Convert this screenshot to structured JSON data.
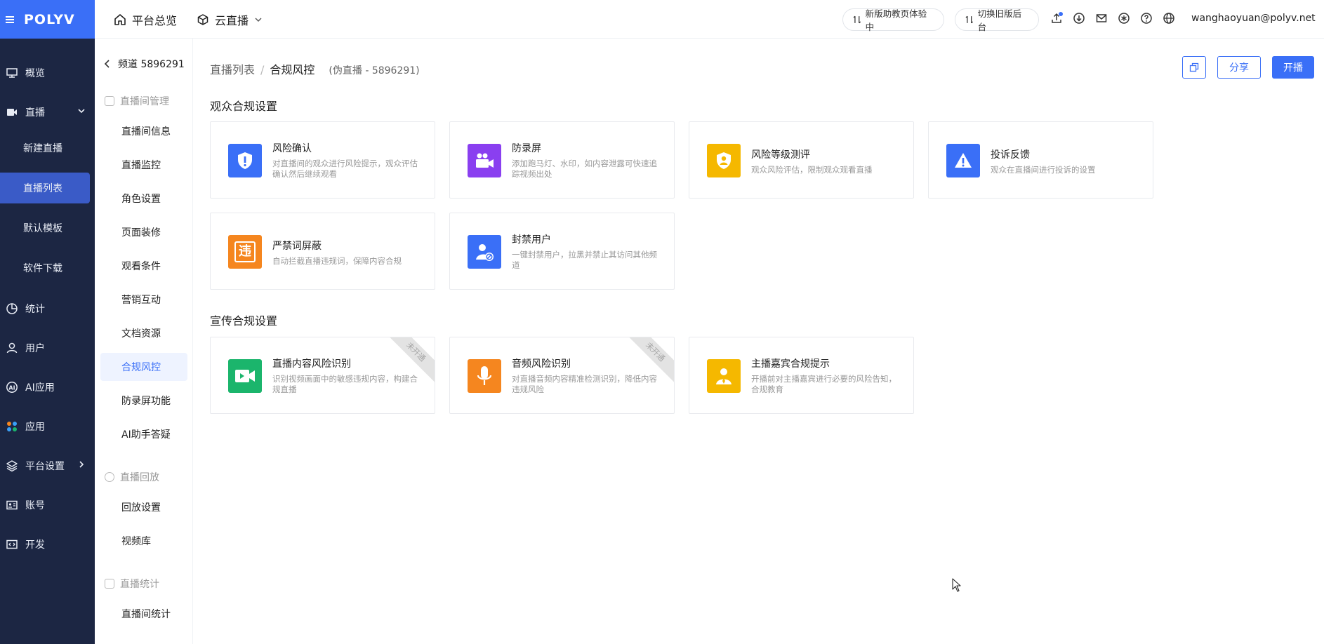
{
  "header": {
    "brand": "POLYV",
    "nav_home": "平台总览",
    "nav_cloud": "云直播",
    "pill_newpage": "新版助教页体验中",
    "pill_oldpage": "切换旧版后台",
    "user_email": "wanghaoyuan@polyv.net"
  },
  "sidebar": {
    "overview": "概览",
    "live": "直播",
    "live_sub": [
      "新建直播",
      "直播列表",
      "默认模板",
      "软件下载"
    ],
    "stats": "统计",
    "users": "用户",
    "ai_apps": "AI应用",
    "apps": "应用",
    "platform_settings": "平台设置",
    "account": "账号",
    "dev": "开发"
  },
  "submenu": {
    "channel": "频道 5896291",
    "group_room": "直播间管理",
    "room_items": [
      "直播间信息",
      "直播监控",
      "角色设置",
      "页面装修",
      "观看条件",
      "营销互动",
      "文档资源",
      "合规风控",
      "防录屏功能",
      "AI助手答疑"
    ],
    "group_replay": "直播回放",
    "replay_items": [
      "回放设置",
      "视频库"
    ],
    "group_stats": "直播统计",
    "stats_items": [
      "直播间统计"
    ]
  },
  "main": {
    "breadcrumb_parent": "直播列表",
    "breadcrumb_sep": "/",
    "breadcrumb_current": "合规风控",
    "breadcrumb_meta": "(伪直播 - 5896291)",
    "share_btn": "分享",
    "live_btn": "开播",
    "section_audience": "观众合规设置",
    "section_promo": "宣传合规设置",
    "cards_audience": [
      {
        "title": "风险确认",
        "desc": "对直播间的观众进行风险提示，观众评估确认然后继续观看",
        "color": "#3a6ff7",
        "icon": "shield-alert-icon"
      },
      {
        "title": "防录屏",
        "desc": "添加跑马灯、水印，如内容泄露可快速追踪视频出处",
        "color": "#8a3ff0",
        "icon": "video-camera-icon"
      },
      {
        "title": "风险等级测评",
        "desc": "观众风险评估，限制观众观看直播",
        "color": "#f5b800",
        "icon": "user-shield-icon"
      },
      {
        "title": "投诉反馈",
        "desc": "观众在直播间进行投诉的设置",
        "color": "#3a6ff7",
        "icon": "warning-triangle-icon"
      },
      {
        "title": "严禁词屏蔽",
        "desc": "自动拦截直播违规词，保障内容合规",
        "color": "#f5861f",
        "icon": "banned-word-icon",
        "glyph": "违"
      },
      {
        "title": "封禁用户",
        "desc": "一键封禁用户，拉黑并禁止其访问其他频道",
        "color": "#3a6ff7",
        "icon": "ban-user-icon"
      }
    ],
    "cards_promo": [
      {
        "title": "直播内容风险识别",
        "desc": "识别视频画面中的敏感违规内容，构建合规直播",
        "color": "#1bb56c",
        "icon": "video-recognition-icon",
        "ribbon": "未开通"
      },
      {
        "title": "音频风险识别",
        "desc": "对直播音频内容精准检测识别，降低内容违规风险",
        "color": "#f5861f",
        "icon": "microphone-icon",
        "ribbon": "未开通"
      },
      {
        "title": "主播嘉宾合规提示",
        "desc": "开播前对主播嘉宾进行必要的风险告知，合规教育",
        "color": "#f5b800",
        "icon": "host-badge-icon"
      }
    ]
  }
}
